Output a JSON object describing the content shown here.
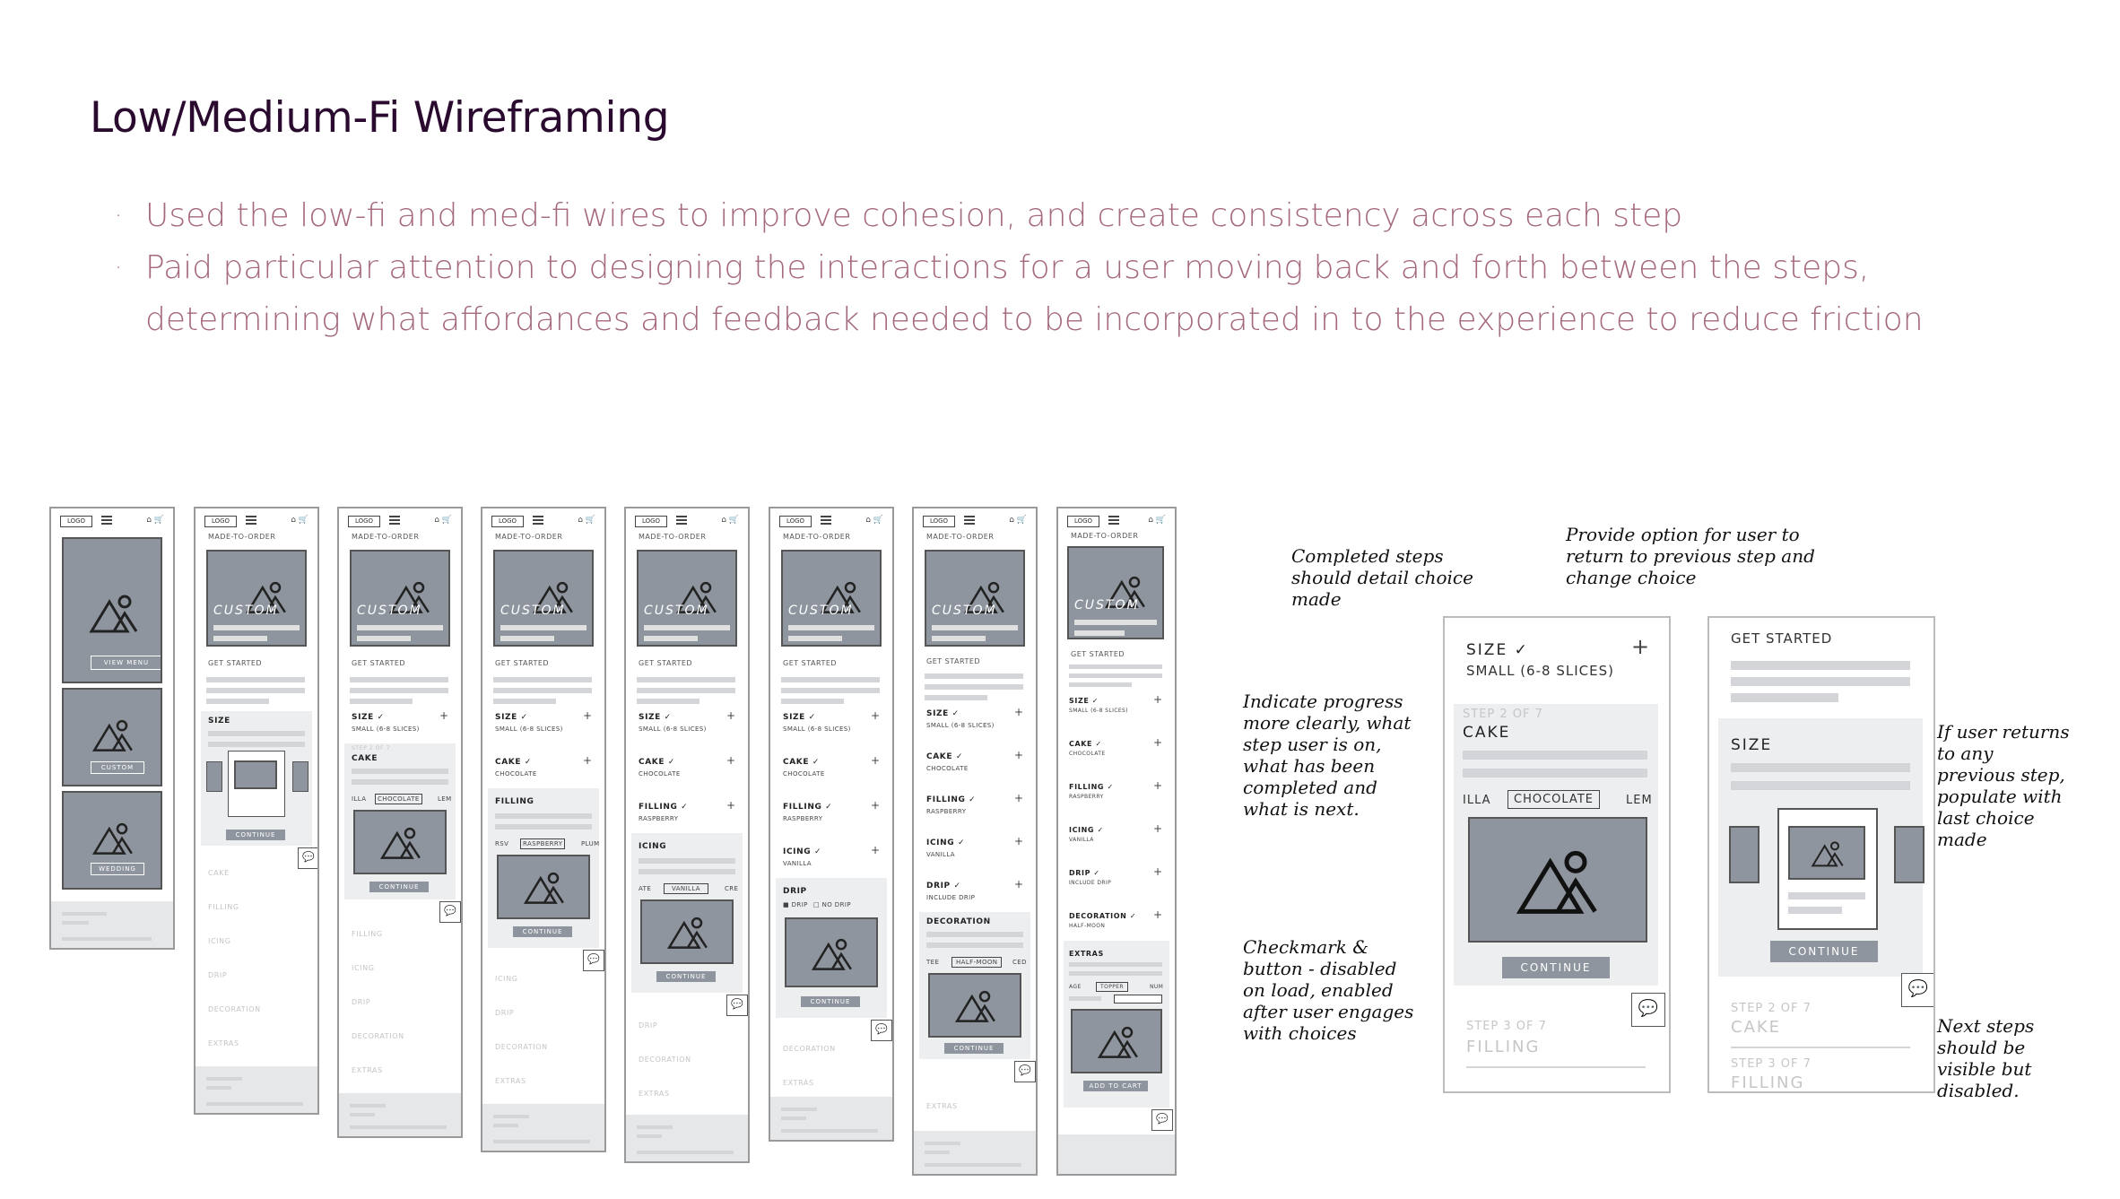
{
  "slide": {
    "title": "Low/Medium-Fi Wireframing",
    "bullets": [
      "Used the low-fi and med-fi wires to improve cohesion, and create consistency across each step",
      "Paid particular attention to designing the interactions for a user moving back and forth between the steps, determining what affordances and feedback needed to be incorporated in to the experience to reduce friction"
    ]
  },
  "wireframes": {
    "logo": "LOGO",
    "made_to_order": "MADE-TO-ORDER",
    "custom": "CUSTOM",
    "get_started": "GET STARTED",
    "continue": "CONTINUE",
    "view_menu": "VIEW MENU",
    "wedding": "WEDDING",
    "add_to_cart": "ADD TO CART",
    "size": "SIZE",
    "size_done": "SIZE ✓",
    "small": "SMALL (6-8 SLICES)",
    "step_label": "STEP 2 OF 7",
    "cake": "CAKE",
    "cake_done": "CAKE ✓",
    "chocolate": "CHOCOLATE",
    "illa": "ILLA",
    "lem": "LEM",
    "filling": "FILLING",
    "filling_done": "FILLING ✓",
    "raspberry": "RASPBERRY",
    "rsv": "RSV",
    "plum": "PLUM",
    "icing": "ICING",
    "icing_done": "ICING ✓",
    "vanilla": "VANILLA",
    "ate": "ATE",
    "cre": "CRE",
    "drip": "DRIP",
    "drip_done": "DRIP ✓",
    "drip_opt": "DRIP",
    "no_drip": "NO DRIP",
    "include_drip": "INCLUDE DRIP",
    "decoration": "DECORATION",
    "decoration_done": "DECORATION ✓",
    "half_moon": "HALF-MOON",
    "tee": "TEE",
    "ced": "CED",
    "extras": "EXTRAS",
    "age": "AGE",
    "topper": "TOPPER",
    "num": "NUM"
  },
  "annotations": {
    "completed_steps": "Completed steps should detail choice made",
    "provide_option": "Provide option for user to return to previous step and change choice",
    "indicate_progress": "Indicate progress more clearly, what step user is on, what has been completed and what is next.",
    "checkmark_button": "Checkmark & button - disabled on load, enabled after user engages with choices",
    "if_user_returns": "If user returns to any previous step, populate with last choice made",
    "next_steps": "Next steps should be visible but disabled."
  },
  "zoom_a": {
    "size_label": "SIZE ✓",
    "size_value": "SMALL (6-8 SLICES)",
    "step_label": "STEP 2 OF 7",
    "cake_label": "CAKE",
    "left_option": "ILLA",
    "selected_option": "CHOCOLATE",
    "right_option": "LEM",
    "continue": "CONTINUE",
    "next_step_label": "STEP 3 OF 7",
    "next_step": "FILLING"
  },
  "zoom_b": {
    "get_started": "GET STARTED",
    "size_label": "SIZE",
    "continue": "CONTINUE",
    "next_step_label": "STEP 2 OF 7",
    "next_step": "CAKE",
    "following_step_label": "STEP 3 OF 7",
    "following_step": "FILLING"
  }
}
